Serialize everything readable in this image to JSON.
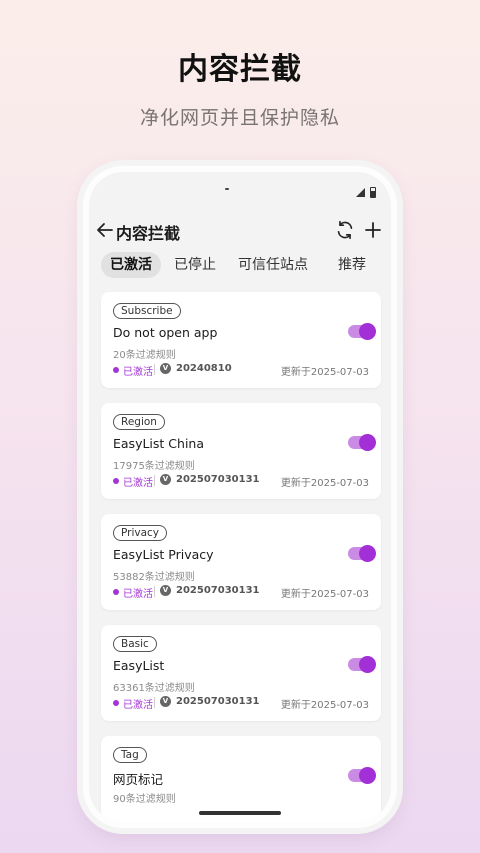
{
  "promo": {
    "title": "内容拦截",
    "subtitle": "净化网页并且保护隐私"
  },
  "appbar": {
    "title": "内容拦截"
  },
  "tabs": [
    {
      "label": "已激活",
      "active": true
    },
    {
      "label": "已停止",
      "active": false
    },
    {
      "label": "可信任站点",
      "active": false
    },
    {
      "label": "推荐",
      "active": false
    }
  ],
  "filters": [
    {
      "badge": "Subscribe",
      "name": "Do not open app",
      "rules": "20条过滤规则",
      "status": "已激活",
      "version": "20240810",
      "updated": "更新于2025-07-03",
      "enabled": true
    },
    {
      "badge": "Region",
      "name": "EasyList China",
      "rules": "17975条过滤规则",
      "status": "已激活",
      "version": "202507030131",
      "updated": "更新于2025-07-03",
      "enabled": true
    },
    {
      "badge": "Privacy",
      "name": "EasyList Privacy",
      "rules": "53882条过滤规则",
      "status": "已激活",
      "version": "202507030131",
      "updated": "更新于2025-07-03",
      "enabled": true
    },
    {
      "badge": "Basic",
      "name": "EasyList",
      "rules": "63361条过滤规则",
      "status": "已激活",
      "version": "202507030131",
      "updated": "更新于2025-07-03",
      "enabled": true
    },
    {
      "badge": "Tag",
      "name": "网页标记",
      "rules": "90条过滤规则",
      "enabled": true
    }
  ],
  "colors": {
    "accent": "#a335d6",
    "toggle_track": "#c98be4",
    "background_top": "#fbeeea",
    "background_bottom": "#ecd8f1"
  },
  "icons": {
    "back": "arrow-left-icon",
    "sync": "refresh-icon",
    "add": "plus-icon",
    "version": "v-badge-icon"
  }
}
